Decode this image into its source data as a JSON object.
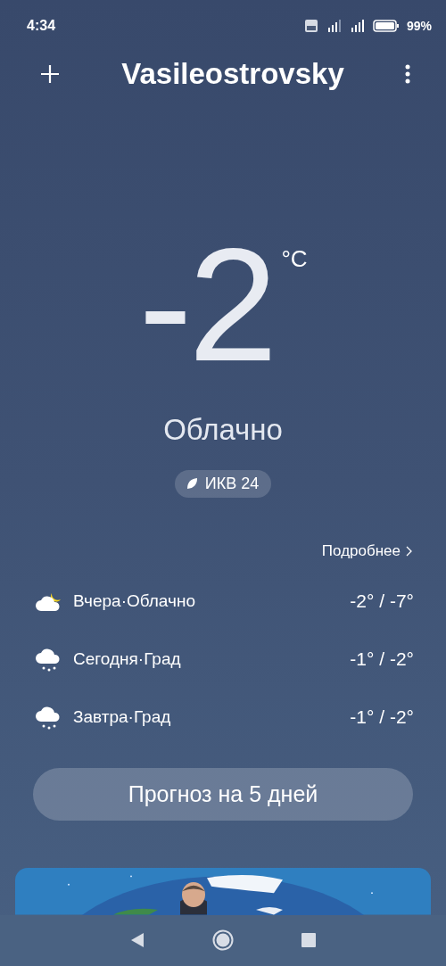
{
  "status_bar": {
    "time": "4:34",
    "battery": "99%"
  },
  "header": {
    "title": "Vasileostrovsky"
  },
  "current": {
    "temperature": "-2",
    "unit": "°C",
    "condition": "Облачно",
    "air_quality": "ИКВ 24"
  },
  "details_link": "Подробнее",
  "forecast": [
    {
      "kind": "partly_cloudy",
      "label": "Вчера·Облачно",
      "temps": "-2° / -7°"
    },
    {
      "kind": "hail",
      "label": "Сегодня·Град",
      "temps": "-1° / -2°"
    },
    {
      "kind": "hail",
      "label": "Завтра·Град",
      "temps": "-1° / -2°"
    }
  ],
  "forecast_button": "Прогноз на 5 дней"
}
